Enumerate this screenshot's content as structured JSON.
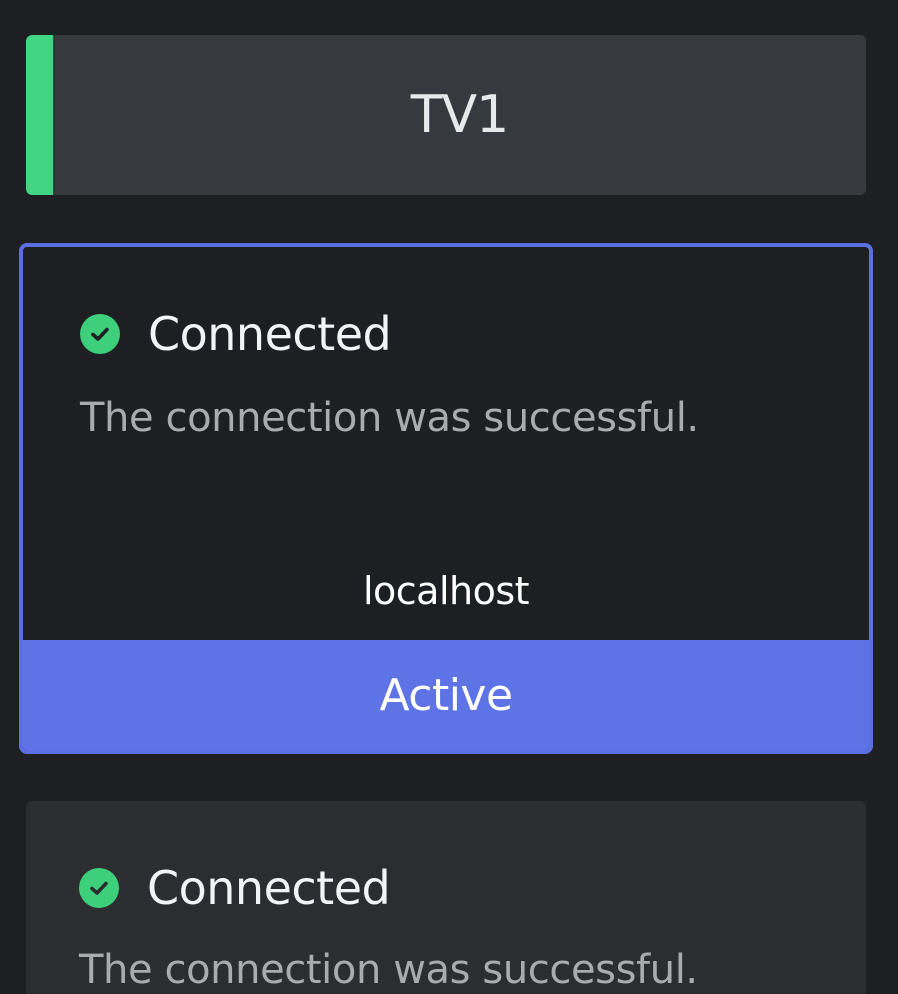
{
  "group": {
    "title": "TV1",
    "accent_color": "#43d682"
  },
  "connections": [
    {
      "status_title": "Connected",
      "status_message": "The connection was successful.",
      "status_icon": "check-circle-icon",
      "status_color": "#3ecf7b",
      "host": "localhost",
      "state_label": "Active",
      "state_color": "#5e73e6"
    },
    {
      "status_title": "Connected",
      "status_message": "The connection was successful.",
      "status_icon": "check-circle-icon",
      "status_color": "#3ecf7b"
    }
  ]
}
